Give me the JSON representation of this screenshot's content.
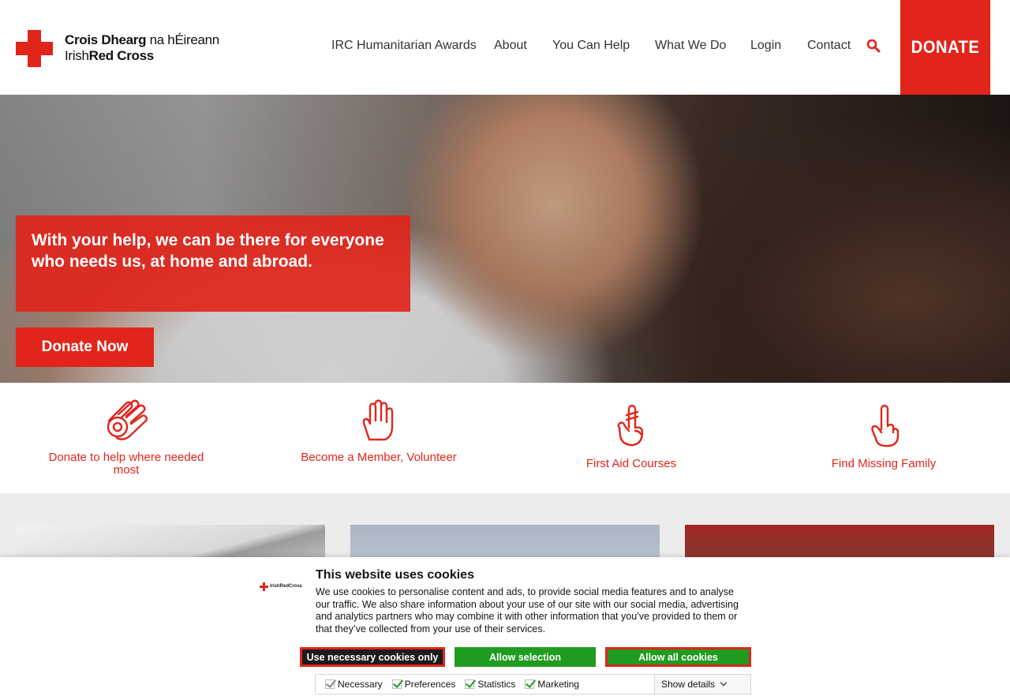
{
  "brand": {
    "name_irish_bold": "Crois Dhearg",
    "name_irish_rest": " na hÉireann",
    "name_english_plain": "Irish",
    "name_english_bold": "Red Cross",
    "accent": "#e1251b"
  },
  "nav": {
    "items": [
      {
        "label": "IRC Humanitarian Awards"
      },
      {
        "label": "About"
      },
      {
        "label": "You Can Help"
      },
      {
        "label": "What We Do"
      },
      {
        "label": "Login"
      },
      {
        "label": "Contact"
      }
    ],
    "search_icon": "search-icon",
    "donate_label": "DONATE"
  },
  "hero": {
    "headline": "With your help, we can be there for everyone who needs us, at home and abroad.",
    "cta_label": "Donate Now"
  },
  "quick_links": [
    {
      "label": "Donate to help where needed most",
      "icon": "hands-icon"
    },
    {
      "label": "Become a Member, Volunteer",
      "icon": "open-hand-icon"
    },
    {
      "label": "First Aid Courses",
      "icon": "bandaged-finger-icon"
    },
    {
      "label": "Find Missing Family",
      "icon": "pointing-hand-icon"
    }
  ],
  "cookie_banner": {
    "logo_text": "IrishRedCross",
    "title": "This website uses cookies",
    "body": "We use cookies to personalise content and ads, to provide social media features and to analyse our traffic. We also share information about your use of our site with our social media, advertising and analytics partners who may combine it with other information that you’ve provided to them or that they’ve collected from your use of their services.",
    "buttons": {
      "necessary_only": "Use necessary cookies only",
      "allow_selection": "Allow selection",
      "allow_all": "Allow all cookies"
    },
    "options": [
      {
        "label": "Necessary",
        "checked": true,
        "disabled": true
      },
      {
        "label": "Preferences",
        "checked": true
      },
      {
        "label": "Statistics",
        "checked": true
      },
      {
        "label": "Marketing",
        "checked": true
      }
    ],
    "show_details": "Show details"
  }
}
